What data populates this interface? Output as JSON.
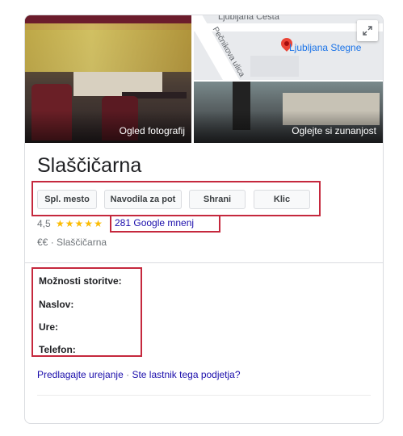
{
  "photos": {
    "left_caption": "Ogled fotografij",
    "right_caption": "Oglejte si zunanjost"
  },
  "map": {
    "street_top": "Ljubljana Cesta",
    "street_side": "Pečnikova ulica",
    "place_label": "Ljubljana Stegne",
    "expand_icon": "expand-icon"
  },
  "business": {
    "name": "Slaščičarna",
    "rating": "4,5",
    "stars_glyph": "★★★★★",
    "reviews": "281 Google mnenj",
    "price": "€€",
    "separator": "·",
    "category": "Slaščičarna"
  },
  "actions": [
    {
      "label": "Spl. mesto"
    },
    {
      "label": "Navodila za pot"
    },
    {
      "label": "Shrani"
    },
    {
      "label": "Klic"
    }
  ],
  "info": {
    "service_options": "Možnosti storitve:",
    "address": "Naslov:",
    "hours": "Ure:",
    "phone": "Telefon:"
  },
  "footer": {
    "suggest_edit": "Predlagajte urejanje",
    "separator": "·",
    "owner_question": "Ste lastnik tega podjetja?"
  },
  "colors": {
    "highlight_border": "#c5283d",
    "link": "#1a0dab",
    "star": "#fbbc04"
  }
}
